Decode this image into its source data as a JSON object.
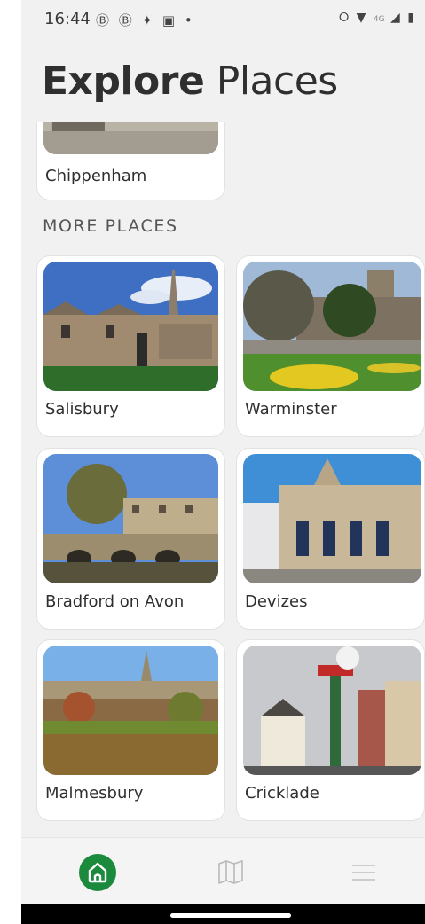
{
  "status_bar": {
    "time": "16:44",
    "left_icons": "Ⓑ Ⓑ ✦ ▣ •",
    "network": "4G"
  },
  "header": {
    "title_bold": "Explore",
    "title_light": "Places"
  },
  "partial_card": {
    "label": "Chippenham"
  },
  "section_title": "MORE PLACES",
  "places": [
    {
      "label": "Salisbury"
    },
    {
      "label": "Warminster"
    },
    {
      "label": "Bradford on Avon"
    },
    {
      "label": "Devizes"
    },
    {
      "label": "Malmesbury"
    },
    {
      "label": "Cricklade"
    }
  ],
  "bottom_nav": {
    "items": [
      "home-icon",
      "map-icon",
      "menu-icon"
    ],
    "active": "home-icon",
    "accent_color": "#1b8a3c"
  }
}
